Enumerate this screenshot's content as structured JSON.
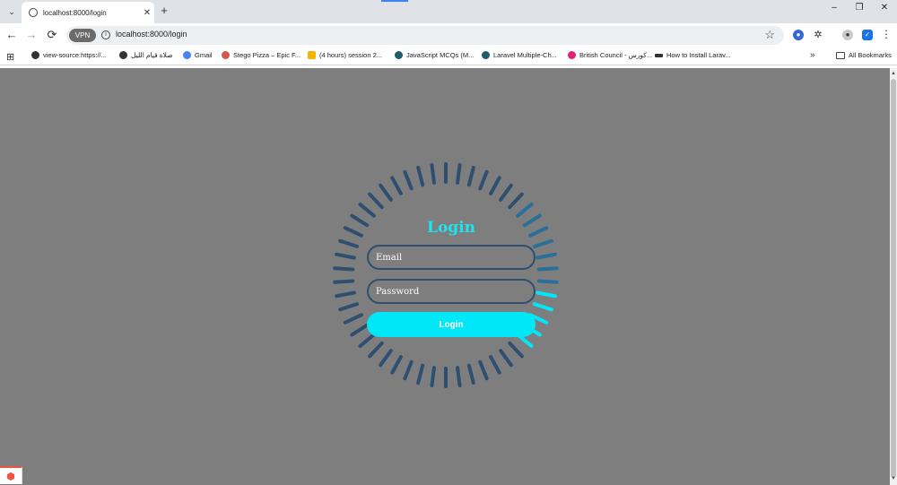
{
  "tab": {
    "title": "localhost:8000/login",
    "close": "✕"
  },
  "new_tab": "+",
  "tab_list": "⌄",
  "window_controls": {
    "minimize": "–",
    "restore": "❐",
    "close": "✕"
  },
  "nav": {
    "back": "←",
    "forward": "→",
    "reload": "⟳"
  },
  "omnibox": {
    "vpn": "VPN",
    "url": "localhost:8000/login",
    "info": "i",
    "bookmark": "☆"
  },
  "extensions": [
    "shield-icon",
    "puzzle-icon",
    "profile-icon",
    "security-icon"
  ],
  "menu": "⋮",
  "bookmarks": {
    "apps": "⊞",
    "items": [
      {
        "label": "view-source:https://...",
        "color": "#333333"
      },
      {
        "label": "صلاة قيام الليل",
        "color": "#333333"
      },
      {
        "label": "Gmail",
        "color": "#4285f4"
      },
      {
        "label": "Stego Pizza – Epic F...",
        "color": "#d9534f"
      },
      {
        "label": "(4 hours) session 2...",
        "color": "#f4b400"
      },
      {
        "label": "JavaScript MCQs (M...",
        "color": "#1e5d6b"
      },
      {
        "label": "Laravel Multiple-Ch...",
        "color": "#1e5d6b"
      },
      {
        "label": "British Council - كورس...",
        "color": "#e0247a"
      },
      {
        "label": "How to Install Larav...",
        "color": "#333333"
      }
    ],
    "more": "»",
    "all": "All Bookmarks"
  },
  "login": {
    "title": "Login",
    "email_placeholder": "Email",
    "password_placeholder": "Password",
    "button": "Login",
    "accent_color": "#00e8f8",
    "ring_color": "#2f4f71"
  },
  "scrollbar": {
    "up": "▲",
    "down": "▼"
  }
}
